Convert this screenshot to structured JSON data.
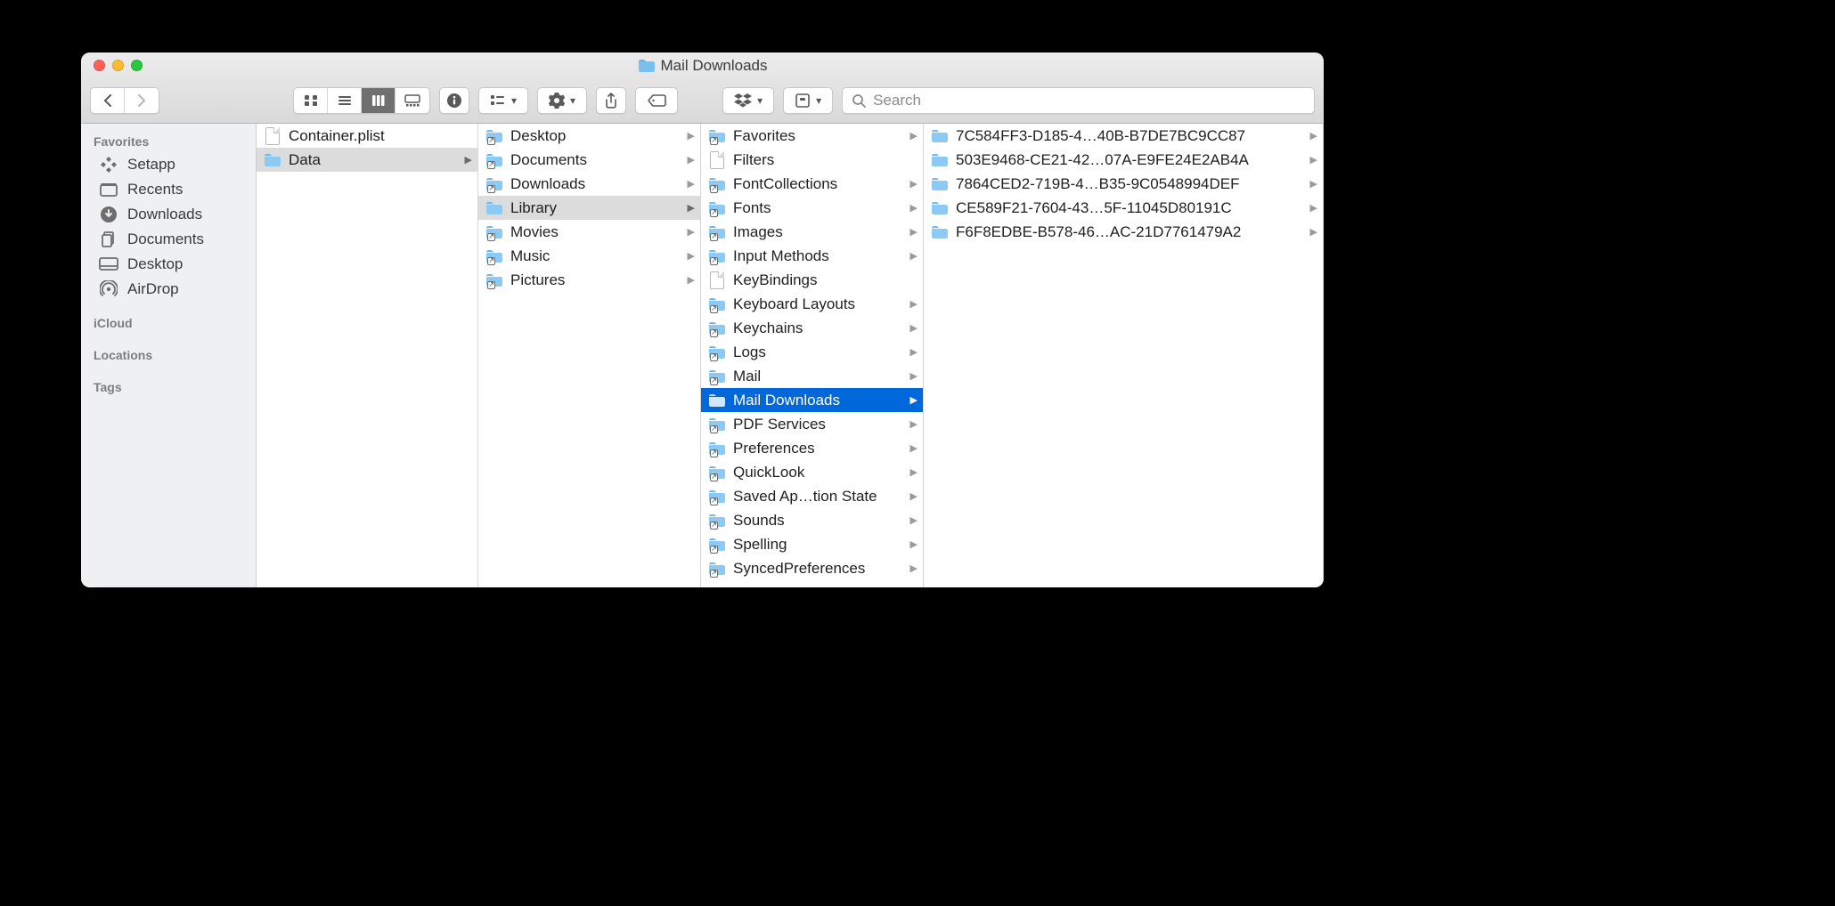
{
  "window": {
    "title": "Mail Downloads"
  },
  "toolbar": {
    "search_placeholder": "Search"
  },
  "sidebar": {
    "sections": [
      {
        "title": "Favorites",
        "items": [
          {
            "icon": "grid-icon",
            "label": "Setapp"
          },
          {
            "icon": "recents-icon",
            "label": "Recents"
          },
          {
            "icon": "downloads-icon",
            "label": "Downloads"
          },
          {
            "icon": "documents-icon",
            "label": "Documents"
          },
          {
            "icon": "desktop-icon",
            "label": "Desktop"
          },
          {
            "icon": "airdrop-icon",
            "label": "AirDrop"
          }
        ]
      },
      {
        "title": "iCloud",
        "items": []
      },
      {
        "title": "Locations",
        "items": []
      },
      {
        "title": "Tags",
        "items": []
      }
    ]
  },
  "columns": [
    {
      "items": [
        {
          "type": "file",
          "label": "Container.plist",
          "arrow": false,
          "selected": false
        },
        {
          "type": "folder",
          "label": "Data",
          "arrow": true,
          "selected": "grey"
        }
      ]
    },
    {
      "items": [
        {
          "type": "alias",
          "label": "Desktop",
          "arrow": true
        },
        {
          "type": "alias",
          "label": "Documents",
          "arrow": true
        },
        {
          "type": "alias",
          "label": "Downloads",
          "arrow": true
        },
        {
          "type": "folder",
          "label": "Library",
          "arrow": true,
          "selected": "grey"
        },
        {
          "type": "alias",
          "label": "Movies",
          "arrow": true
        },
        {
          "type": "alias",
          "label": "Music",
          "arrow": true
        },
        {
          "type": "alias",
          "label": "Pictures",
          "arrow": true
        }
      ]
    },
    {
      "items": [
        {
          "type": "alias",
          "label": "Favorites",
          "arrow": true
        },
        {
          "type": "file",
          "label": "Filters"
        },
        {
          "type": "alias",
          "label": "FontCollections",
          "arrow": true
        },
        {
          "type": "alias",
          "label": "Fonts",
          "arrow": true
        },
        {
          "type": "alias",
          "label": "Images",
          "arrow": true
        },
        {
          "type": "alias",
          "label": "Input Methods",
          "arrow": true
        },
        {
          "type": "file",
          "label": "KeyBindings"
        },
        {
          "type": "alias",
          "label": "Keyboard Layouts",
          "arrow": true
        },
        {
          "type": "alias",
          "label": "Keychains",
          "arrow": true
        },
        {
          "type": "alias",
          "label": "Logs",
          "arrow": true
        },
        {
          "type": "alias",
          "label": "Mail",
          "arrow": true
        },
        {
          "type": "folder",
          "label": "Mail Downloads",
          "arrow": true,
          "selected": "blue"
        },
        {
          "type": "alias",
          "label": "PDF Services",
          "arrow": true
        },
        {
          "type": "alias",
          "label": "Preferences",
          "arrow": true
        },
        {
          "type": "alias",
          "label": "QuickLook",
          "arrow": true
        },
        {
          "type": "alias",
          "label": "Saved Ap…tion State",
          "arrow": true,
          "raw": true
        },
        {
          "type": "alias",
          "label": "Sounds",
          "arrow": true
        },
        {
          "type": "alias",
          "label": "Spelling",
          "arrow": true
        },
        {
          "type": "alias",
          "label": "SyncedPreferences",
          "arrow": true
        }
      ]
    },
    {
      "items": [
        {
          "type": "folder",
          "arrow": true,
          "left": "7C584FF3-D185-4…",
          "right": "40B-B7DE7BC9CC87"
        },
        {
          "type": "folder",
          "arrow": true,
          "left": "503E9468-CE21-42…",
          "right": "07A-E9FE24E2AB4A"
        },
        {
          "type": "folder",
          "arrow": true,
          "left": "7864CED2-719B-4…",
          "right": "B35-9C0548994DEF"
        },
        {
          "type": "folder",
          "arrow": true,
          "left": "CE589F21-7604-43…",
          "right": "5F-11045D80191C"
        },
        {
          "type": "folder",
          "arrow": true,
          "left": "F6F8EDBE-B578-46…",
          "right": "AC-21D7761479A2"
        }
      ]
    }
  ]
}
